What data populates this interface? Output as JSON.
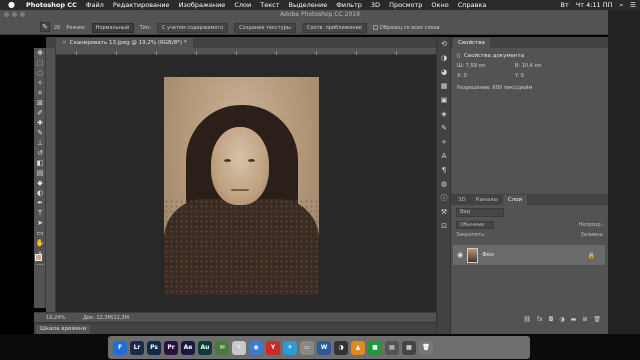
{
  "menubar": {
    "app_name": "Photoshop CC",
    "items": [
      "Файл",
      "Редактирование",
      "Изображение",
      "Слои",
      "Текст",
      "Выделение",
      "Фильтр",
      "3D",
      "Просмотр",
      "Окно",
      "Справка"
    ],
    "clock": "Чт 4:11 ПП",
    "keyboard_layout": "Вт"
  },
  "window": {
    "title": "Adobe Photoshop CC 2019"
  },
  "options_bar": {
    "brush_size": "20",
    "mode_label": "Режим:",
    "mode_value": "Нормальный",
    "type_label": "Тип:",
    "type_options": [
      "С учетом содержимого",
      "Создание текстуры",
      "Соотв. приближение"
    ],
    "sample_all_layers": "Образец со всех слоев"
  },
  "document": {
    "tab_title": "Сканировать 13.jpeg @ 19,2% (RGB/8*) *",
    "zoom": "19,24%",
    "doc_info": "Док: 12,3M/12,3M"
  },
  "timeline": {
    "label": "Шкала времени"
  },
  "properties": {
    "tab": "Свойства",
    "section": "Свойства документа",
    "width_label": "Ш:",
    "width_value": "7,59 см",
    "height_label": "В:",
    "height_value": "10,4 см",
    "x_label": "X:",
    "x_value": "0",
    "y_label": "Y:",
    "y_value": "0",
    "resolution": "Разрешение: 600 пикс/дюйм"
  },
  "layers_panel": {
    "tabs": [
      "3D",
      "Каналы",
      "Слои"
    ],
    "active_tab": "Слои",
    "filter_label": "Вид",
    "blend_mode": "Обычные",
    "opacity_label": "Непрозр.:",
    "lock_label": "Закрепить:",
    "fill_label": "Заливка:",
    "layers": [
      {
        "name": "Фон",
        "locked": true
      }
    ]
  },
  "dock": {
    "apps": [
      {
        "label": "F",
        "color": "#1e6fd9"
      },
      {
        "label": "Lr",
        "color": "#1a2b4a"
      },
      {
        "label": "Ps",
        "color": "#0f2a4a"
      },
      {
        "label": "Pr",
        "color": "#2a1240"
      },
      {
        "label": "Ae",
        "color": "#1d1640"
      },
      {
        "label": "Au",
        "color": "#0b3a3a"
      },
      {
        "label": "✉",
        "color": "#4a7a3a"
      },
      {
        "label": "✎",
        "color": "#c8c8c8"
      },
      {
        "label": "◉",
        "color": "#3a7bd5"
      },
      {
        "label": "Y",
        "color": "#cc2a2a"
      },
      {
        "label": "✈",
        "color": "#2a9bd5"
      },
      {
        "label": "▭",
        "color": "#888888"
      },
      {
        "label": "W",
        "color": "#2a5a9a"
      },
      {
        "label": "◑",
        "color": "#333333"
      },
      {
        "label": "▲",
        "color": "#e08a1e"
      },
      {
        "label": "■",
        "color": "#1e9a3a"
      },
      {
        "label": "▤",
        "color": "#555555"
      },
      {
        "label": "▦",
        "color": "#444444"
      },
      {
        "label": "🗑",
        "color": "#777777"
      }
    ]
  }
}
